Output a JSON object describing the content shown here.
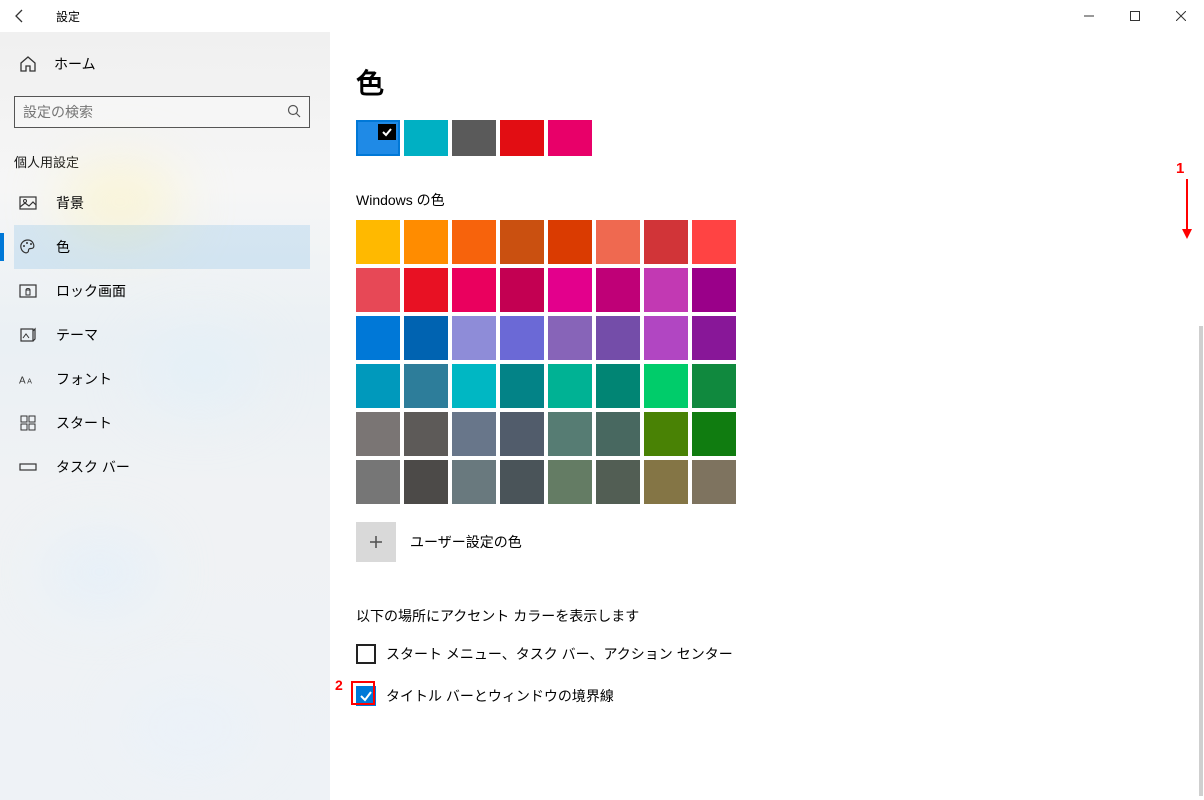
{
  "window": {
    "title": "設定"
  },
  "sidebar": {
    "home_label": "ホーム",
    "search_placeholder": "設定の検索",
    "section_title": "個人用設定",
    "items": [
      {
        "icon": "picture-icon",
        "label": "背景"
      },
      {
        "icon": "palette-icon",
        "label": "色",
        "active": true
      },
      {
        "icon": "lock-icon",
        "label": "ロック画面"
      },
      {
        "icon": "theme-icon",
        "label": "テーマ"
      },
      {
        "icon": "font-icon",
        "label": "フォント"
      },
      {
        "icon": "start-icon",
        "label": "スタート"
      },
      {
        "icon": "taskbar-icon",
        "label": "タスク バー"
      }
    ]
  },
  "page": {
    "title": "色",
    "recent_colors": [
      {
        "hex": "#1f8ae6",
        "selected": true
      },
      {
        "hex": "#00b0c3"
      },
      {
        "hex": "#5a5a5a"
      },
      {
        "hex": "#e20d13"
      },
      {
        "hex": "#e80069"
      }
    ],
    "windows_colors_label": "Windows の色",
    "windows_colors": [
      "#ffb900",
      "#ff8c00",
      "#f7630c",
      "#ca5010",
      "#da3b01",
      "#ef6950",
      "#d13438",
      "#ff4343",
      "#e74856",
      "#e81123",
      "#ea005e",
      "#c30052",
      "#e3008c",
      "#bf0077",
      "#c239b3",
      "#9a0089",
      "#0078d7",
      "#0063b1",
      "#8e8cd8",
      "#6b69d6",
      "#8764b8",
      "#744da9",
      "#b146c2",
      "#881798",
      "#0099bc",
      "#2d7d9a",
      "#00b7c3",
      "#038387",
      "#00b294",
      "#018574",
      "#00cc6a",
      "#10893e",
      "#7a7574",
      "#5d5a58",
      "#68768a",
      "#515c6b",
      "#567c73",
      "#486860",
      "#498205",
      "#107c10",
      "#767676",
      "#4c4a48",
      "#69797e",
      "#4a5459",
      "#647c64",
      "#525e54",
      "#847545",
      "#7e735f"
    ],
    "custom_color_label": "ユーザー設定の色",
    "accent_heading": "以下の場所にアクセント カラーを表示します",
    "check_start": "スタート メニュー、タスク バー、アクション センター",
    "check_titlebar": "タイトル バーとウィンドウの境界線"
  },
  "annotations": {
    "num1": "1",
    "num2": "2"
  }
}
